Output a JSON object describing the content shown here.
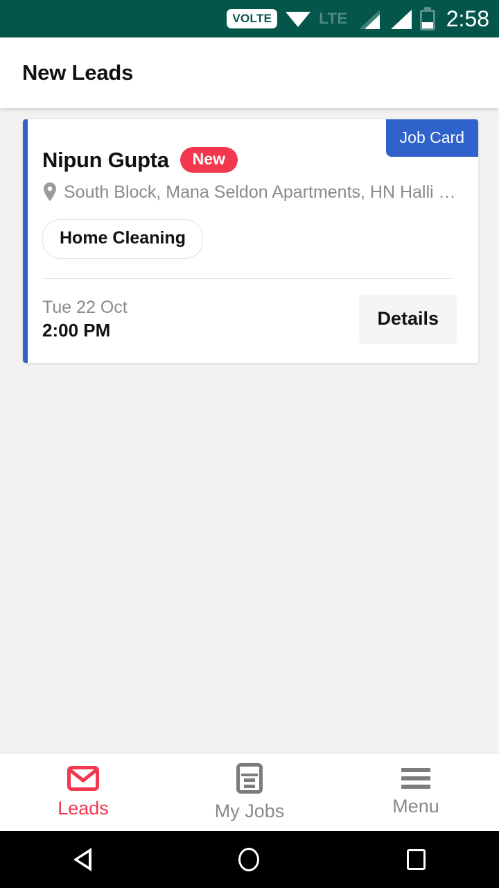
{
  "status_bar": {
    "volte_label": "VOLTE",
    "wifi_icon": "wifi-icon",
    "network_label": "LTE",
    "signal_icon_1": "signal-bars-partial-icon",
    "signal_icon_2": "signal-bars-full-icon",
    "battery_icon": "battery-low-icon",
    "time": "2:58",
    "background_color": "#04564B"
  },
  "app_bar": {
    "title": "New Leads"
  },
  "leads": [
    {
      "customer_name": "Nipun Gupta",
      "badge": "New",
      "badge_color": "#F2384F",
      "job_card_label": "Job Card",
      "job_card_color": "#2F62CA",
      "location_icon": "location-pin-icon",
      "address": "South Block, Mana Seldon Apartments, HN Halli …",
      "service": "Home Cleaning",
      "date": "Tue 22 Oct",
      "time": "2:00 PM",
      "details_label": "Details",
      "accent_color": "#2F62CA"
    }
  ],
  "bottom_nav": {
    "active_color": "#F2384F",
    "inactive_color": "#8A8A8A",
    "items": [
      {
        "label": "Leads",
        "icon": "envelope-icon",
        "active": true
      },
      {
        "label": "My Jobs",
        "icon": "document-icon",
        "active": false
      },
      {
        "label": "Menu",
        "icon": "hamburger-icon",
        "active": false
      }
    ]
  },
  "android_nav": {
    "back_icon": "android-back-icon",
    "home_icon": "android-home-icon",
    "recents_icon": "android-recents-icon"
  }
}
